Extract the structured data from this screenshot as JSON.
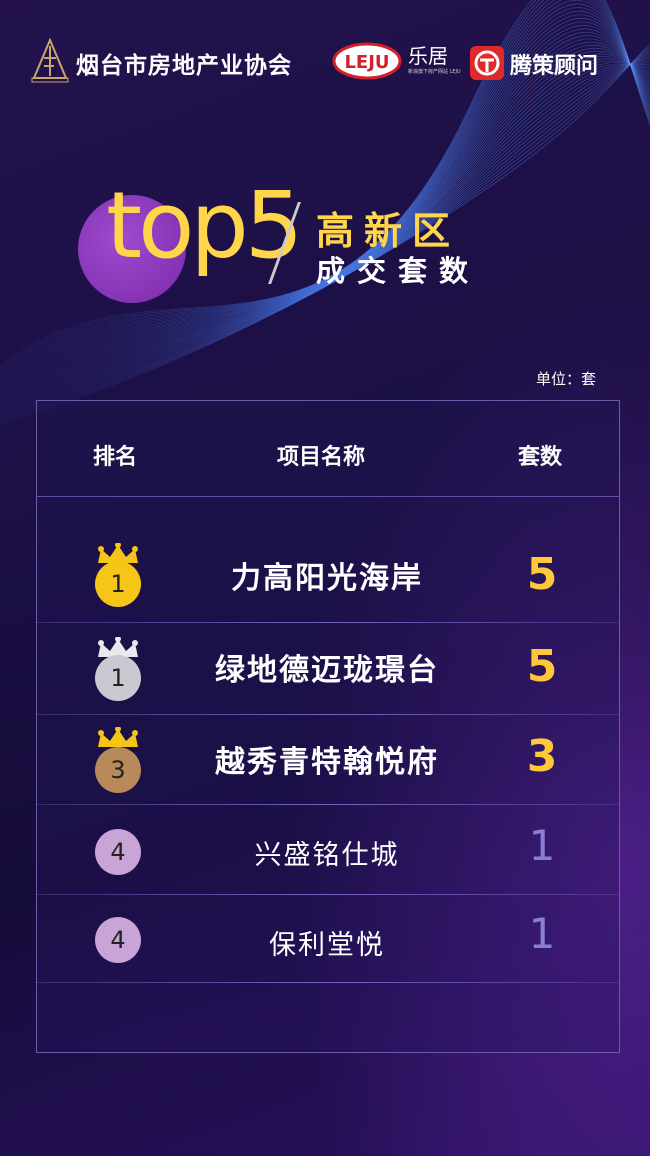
{
  "header": {
    "association_name": "烟台市房地产业协会",
    "leju_name": "乐居",
    "leju_sub": "新浪旗下房产网站 LEJU",
    "leju_logo_text": "LEJU",
    "celue_name": "腾策顾问"
  },
  "title": {
    "big": "top5",
    "region": "高新区",
    "subtitle": "成交套数"
  },
  "unit": "单位：套",
  "table": {
    "columns": [
      "排名",
      "项目名称",
      "套数"
    ],
    "rows": [
      {
        "rank": "1",
        "name": "力高阳光海岸",
        "count": "5",
        "medal": "gold"
      },
      {
        "rank": "1",
        "name": "绿地德迈珑璟台",
        "count": "5",
        "medal": "silver"
      },
      {
        "rank": "3",
        "name": "越秀青特翰悦府",
        "count": "3",
        "medal": "bronze"
      },
      {
        "rank": "4",
        "name": "兴盛铭仕城",
        "count": "1",
        "medal": "none"
      },
      {
        "rank": "4",
        "name": "保利堂悦",
        "count": "1",
        "medal": "none"
      }
    ]
  },
  "colors": {
    "gold": "#f5c518",
    "silver": "#c9c9d2",
    "bronze": "#b8895a",
    "plain": "#c9a4d6",
    "accent_yellow": "#ffd54a"
  }
}
